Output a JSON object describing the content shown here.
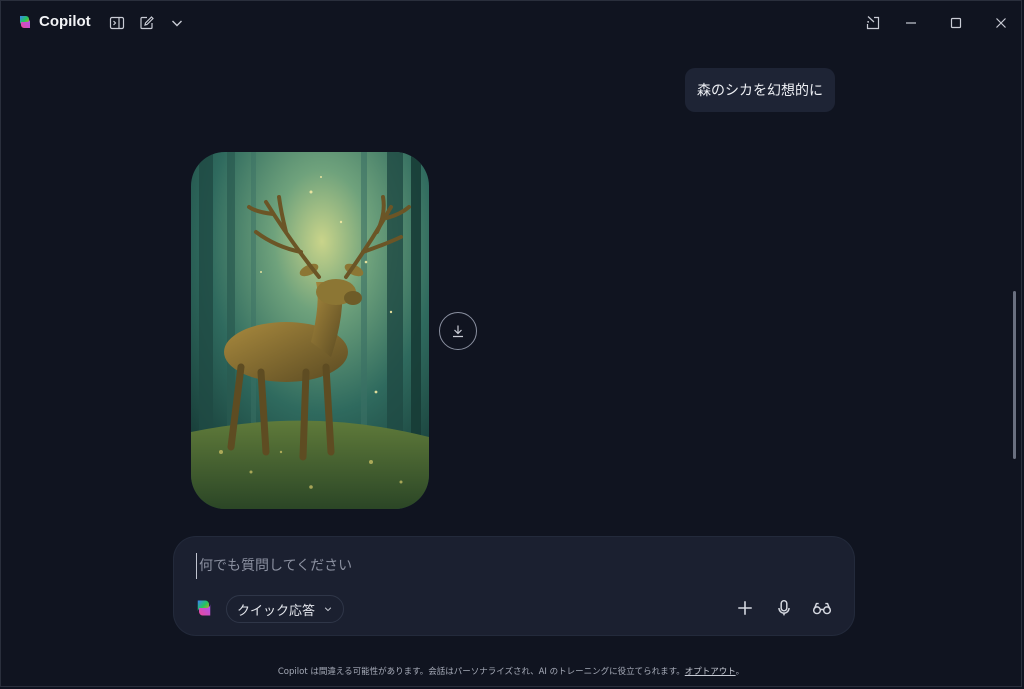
{
  "app": {
    "title": "Copilot"
  },
  "icons": {
    "sidebar": "sidebar-toggle-icon",
    "new_chat": "compose-icon",
    "dropdown": "chevron-down-icon",
    "popout": "pop-out-icon",
    "minimize": "minimize-icon",
    "maximize": "maximize-icon",
    "close": "close-icon"
  },
  "chat": {
    "user_message": "森のシカを幻想的に",
    "image_alt": "fantasy deer in forest"
  },
  "composer": {
    "placeholder": "何でも質問してください",
    "value": "",
    "mode_label": "クイック応答"
  },
  "footer": {
    "disclaimer": "Copilot は間違える可能性があります。会話はパーソナライズされ、AI のトレーニングに役立てられます。",
    "opt_out": "オプトアウト",
    "tail": "。"
  },
  "colors": {
    "background": "#101420",
    "bubble": "#1e2435",
    "composer": "#1b2030"
  }
}
